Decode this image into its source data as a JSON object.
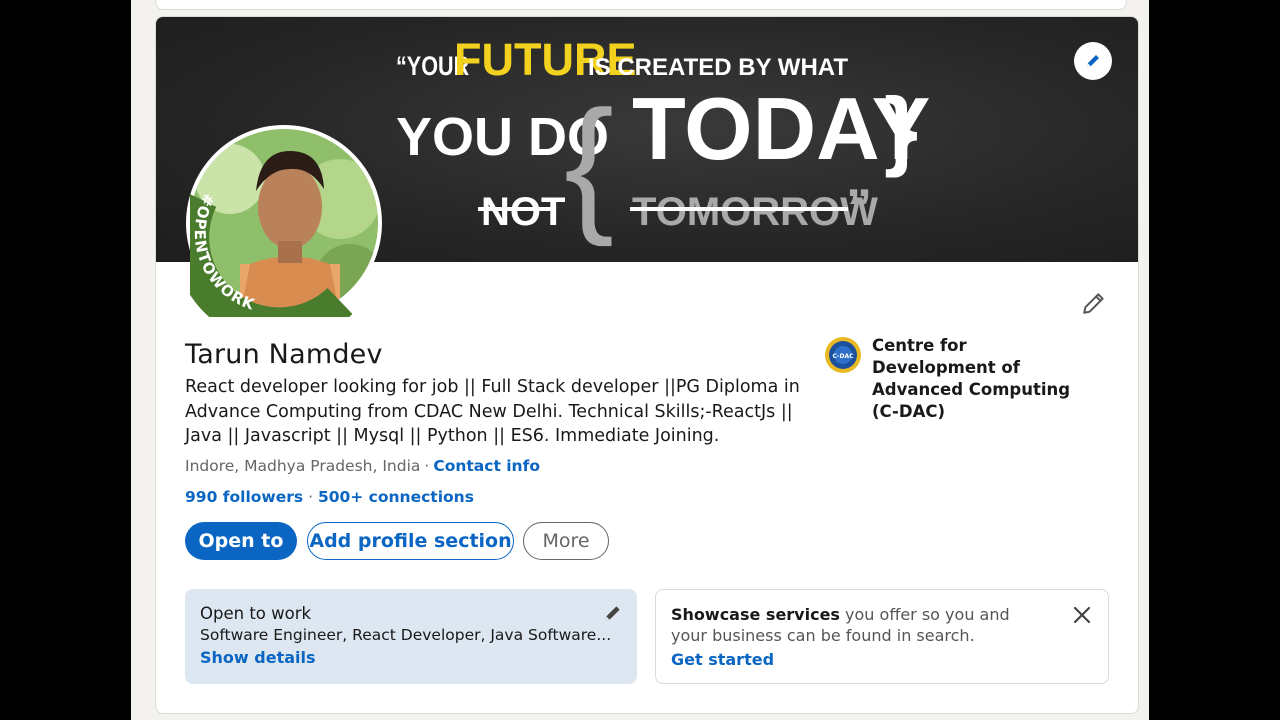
{
  "banner": {
    "quote_open": "“YOUR",
    "future_word": "FUTURE",
    "created_by": "IS CREATED BY WHAT",
    "you_do": "YOU DO",
    "brace_open": "{",
    "today": "TODAY",
    "brace_close": "}",
    "not_word": "NOT",
    "tomorrow": "TOMORROW",
    "quote_close": "”",
    "accent_color": "#f2d21e"
  },
  "avatar": {
    "frame_text": "#OPENTOWORK",
    "frame_color": "#4a7c2e"
  },
  "profile": {
    "name": "Tarun Namdev",
    "headline": "React developer looking for job || Full Stack developer ||PG Diploma in Advance Computing from CDAC New Delhi. Technical Skills;-ReactJs || Java || Javascript || Mysql || Python || ES6. Immediate Joining.",
    "location": "Indore, Madhya Pradesh, India",
    "separator": "·",
    "contact_info": "Contact info",
    "followers": "990 followers",
    "connections": "500+ connections"
  },
  "education": {
    "name": "Centre for Development of Advanced Computing (C-DAC)",
    "logo_text": "C-DAC"
  },
  "actions": {
    "open_to": "Open to",
    "add_section": "Add profile section",
    "more": "More"
  },
  "open_to_work": {
    "title": "Open to work",
    "roles": "Software Engineer, React Developer, Java Software...",
    "link": "Show details"
  },
  "services": {
    "bold": "Showcase services",
    "rest": " you offer so you and your business can be found in search.",
    "link": "Get started"
  },
  "colors": {
    "brand_blue": "#0a66c2",
    "otw_bg": "#dde7f1"
  }
}
